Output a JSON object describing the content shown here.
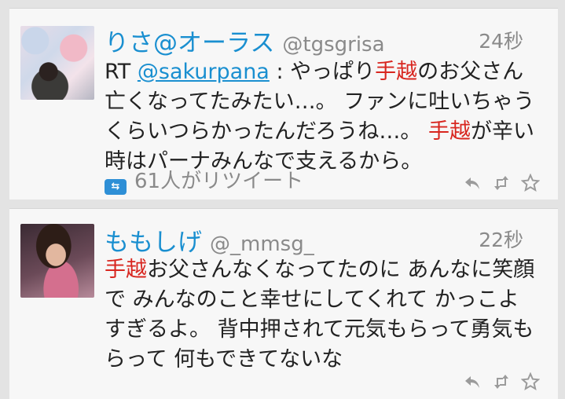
{
  "tweets": [
    {
      "display_name": "りさ@オーラス",
      "username": "@tgsgrisa",
      "time": "24秒",
      "text": {
        "rt_prefix": "RT ",
        "mention": "@sakurpana",
        "p1": " : やっぱり",
        "kw1": "手越",
        "p2": "のお父さん亡くなってたみたい…。 ファンに吐いちゃうくらいつらかったんだろうね…。 ",
        "kw2": "手越",
        "p3": "が辛い時はパーナみんなで支えるから。"
      },
      "retweet_text": "61人がリツイート"
    },
    {
      "display_name": "ももしげ",
      "username": "@_mmsg_",
      "time": "22秒",
      "text": {
        "kw1": "手越",
        "p1": "お父さんなくなってたのに あんなに笑顔で みんなのこと幸せにしてくれて かっこよすぎるよ。 背中押されて元気もらって勇気もらって 何もできてないな"
      }
    }
  ],
  "icons": [
    "reply-icon",
    "retweet-icon",
    "favorite-icon",
    "retweet-count-icon"
  ],
  "colors": {
    "accent": "#1a8fd0",
    "keyword": "#d8261f",
    "muted": "#8a8a8a"
  }
}
